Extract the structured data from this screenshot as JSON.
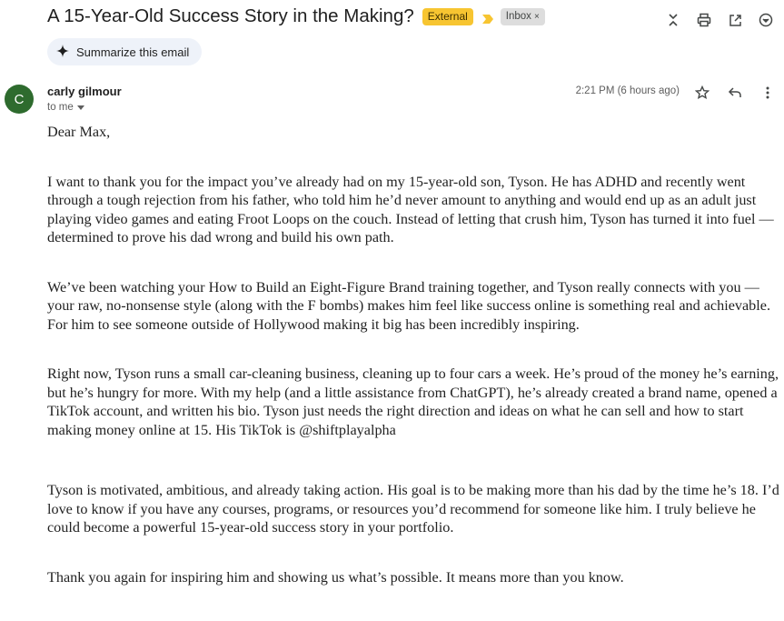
{
  "email": {
    "subject": "A 15-Year-Old Success Story in the Making?",
    "labels": {
      "external": "External",
      "inbox": "Inbox",
      "inbox_remove": "×"
    },
    "summarize_label": "Summarize this email",
    "sender": {
      "initial": "C",
      "name": "carly gilmour",
      "to": "to me"
    },
    "timestamp": "2:21 PM (6 hours ago)",
    "body": {
      "greeting": "Dear Max,",
      "paragraphs": [
        "I want to thank you for the impact you’ve already had on my 15-year-old son, Tyson. He has ADHD and recently went through a tough rejection from his father, who told him he’d never amount to anything and would end up as an adult just playing video games and eating Froot Loops on the couch. Instead of letting that crush him, Tyson has turned it into fuel — determined to prove his dad wrong and build his own path.",
        "We’ve been watching your How to Build an Eight-Figure Brand training together, and Tyson really connects with you — your raw, no-nonsense style (along with the F bombs) makes him feel like success online is something real and achievable. For him to see someone outside of Hollywood making it big has been incredibly inspiring.",
        "Right now, Tyson runs a small car-cleaning business, cleaning up to four cars a week. He’s proud of the money he’s earning, but he’s hungry for more. With my help (and a little assistance from ChatGPT), he’s already created a brand name, opened a TikTok account, and written his bio. Tyson just needs the right direction and ideas on what he can sell and how to start making money online at 15. His TikTok is @shiftplayalpha",
        "Tyson is motivated, ambitious, and already taking action. His goal is to be making more than his dad by the time he’s 18. I’d love to know if you have any courses, programs, or resources you’d recommend for someone like him. I truly believe he could become a powerful 15-year-old success story in your portfolio.",
        "Thank you again for inspiring him and showing us what’s possible. It means more than you know."
      ]
    }
  },
  "icons": {
    "top": [
      "expand-collapse-icon",
      "print-icon",
      "open-in-new-window-icon",
      "more-circle-icon"
    ],
    "message": [
      "star-icon",
      "reply-icon",
      "more-vert-icon"
    ]
  },
  "colors": {
    "external_label": "#f7c531",
    "avatar": "#2e6b2e",
    "summarize_bg": "#eef2f9",
    "inbox_label": "#dddddd"
  }
}
